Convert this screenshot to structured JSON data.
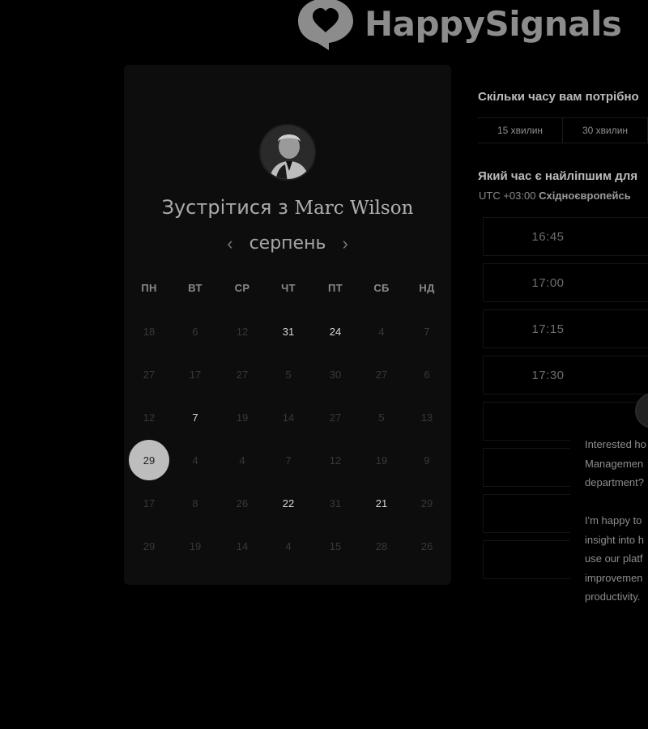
{
  "brand": {
    "name": "HappySignals",
    "logo_icon": "heart-speech-bubble-icon"
  },
  "calendar": {
    "heading_prefix": "Зустрітися з",
    "host_name": "Marc Wilson",
    "month": "серпень",
    "prev_icon": "chevron-left-icon",
    "next_icon": "chevron-right-icon",
    "weekdays": [
      "ПН",
      "ВТ",
      "СР",
      "ЧТ",
      "ПТ",
      "СБ",
      "НД"
    ],
    "weeks": [
      [
        {
          "d": "18"
        },
        {
          "d": "6"
        },
        {
          "d": "12"
        },
        {
          "d": "31",
          "available": true
        },
        {
          "d": "24",
          "available": true
        },
        {
          "d": "4"
        },
        {
          "d": "7"
        }
      ],
      [
        {
          "d": "27"
        },
        {
          "d": "17"
        },
        {
          "d": "27"
        },
        {
          "d": "5"
        },
        {
          "d": "30"
        },
        {
          "d": "27"
        },
        {
          "d": "6"
        }
      ],
      [
        {
          "d": "12"
        },
        {
          "d": "7",
          "available": true
        },
        {
          "d": "19"
        },
        {
          "d": "14"
        },
        {
          "d": "27"
        },
        {
          "d": "5"
        },
        {
          "d": "13"
        }
      ],
      [
        {
          "d": "29",
          "selected": true
        },
        {
          "d": "4"
        },
        {
          "d": "4"
        },
        {
          "d": "7"
        },
        {
          "d": "12"
        },
        {
          "d": "19"
        },
        {
          "d": "9"
        }
      ],
      [
        {
          "d": "17"
        },
        {
          "d": "8"
        },
        {
          "d": "26"
        },
        {
          "d": "22",
          "available": true
        },
        {
          "d": "31"
        },
        {
          "d": "21",
          "available": true
        },
        {
          "d": "29"
        }
      ],
      [
        {
          "d": "29"
        },
        {
          "d": "19"
        },
        {
          "d": "14"
        },
        {
          "d": "4"
        },
        {
          "d": "15"
        },
        {
          "d": "28"
        },
        {
          "d": "26"
        }
      ]
    ]
  },
  "booking": {
    "duration_question": "Скільки часу вам потрібно",
    "durations": [
      "15 хвилин",
      "30 хвилин"
    ],
    "time_question": "Який час є найліпшим для",
    "timezone_offset": "UTC +03:00",
    "timezone_name": "Східноєвропейсь",
    "slots": [
      "16:45",
      "17:00",
      "17:15",
      "17:30",
      "",
      "",
      "",
      ""
    ]
  },
  "chat": {
    "message": "Interested ho\nManagemen\ndepartment?\n\nI'm happy to\ninsight into h\nuse our platf\nimprovemen\nproductivity."
  },
  "colors": {
    "background": "#000000",
    "card": "#0d0d0d",
    "selected_day": "#bdbdbd"
  }
}
